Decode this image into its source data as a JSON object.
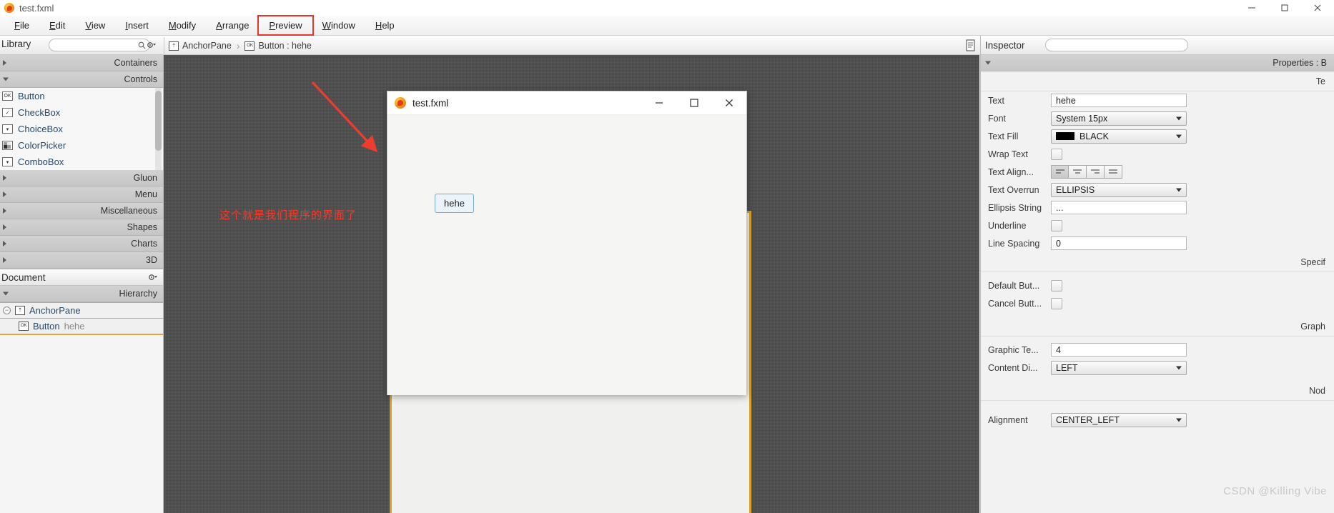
{
  "window": {
    "title": "test.fxml",
    "icon": "scenebuilder-icon",
    "controls": [
      {
        "name": "minimize",
        "glyph": "minimize-icon"
      },
      {
        "name": "maximize",
        "glyph": "maximize-icon"
      },
      {
        "name": "close",
        "glyph": "close-icon"
      }
    ]
  },
  "menubar": {
    "items": [
      {
        "label": "File",
        "mnemonic": "F",
        "highlighted": false
      },
      {
        "label": "Edit",
        "mnemonic": "E",
        "highlighted": false
      },
      {
        "label": "View",
        "mnemonic": "V",
        "highlighted": false
      },
      {
        "label": "Insert",
        "mnemonic": "I",
        "highlighted": false
      },
      {
        "label": "Modify",
        "mnemonic": "M",
        "highlighted": false
      },
      {
        "label": "Arrange",
        "mnemonic": "A",
        "highlighted": false
      },
      {
        "label": "Preview",
        "mnemonic": "P",
        "highlighted": true
      },
      {
        "label": "Window",
        "mnemonic": "W",
        "highlighted": false
      },
      {
        "label": "Help",
        "mnemonic": "H",
        "highlighted": false
      }
    ],
    "highlight_color": "#e8342a"
  },
  "library": {
    "title": "Library",
    "search_placeholder": "",
    "search_value": "",
    "gear_label": "gear-icon",
    "sections": [
      {
        "label": "Containers",
        "open": false
      },
      {
        "label": "Controls",
        "open": true
      }
    ],
    "controls": [
      {
        "label": "Button",
        "icon": "ok-icon"
      },
      {
        "label": "CheckBox",
        "icon": "checkbox-icon"
      },
      {
        "label": "ChoiceBox",
        "icon": "choicebox-icon"
      },
      {
        "label": "ColorPicker",
        "icon": "colorpicker-icon"
      },
      {
        "label": "ComboBox",
        "icon": "combobox-icon"
      }
    ],
    "more_sections": [
      {
        "label": "Gluon"
      },
      {
        "label": "Menu"
      },
      {
        "label": "Miscellaneous"
      },
      {
        "label": "Shapes"
      },
      {
        "label": "Charts"
      },
      {
        "label": "3D"
      }
    ]
  },
  "document": {
    "title": "Document",
    "hierarchy_label": "Hierarchy",
    "tree": [
      {
        "label": "AnchorPane",
        "sub": "",
        "icon": "anchorpane-icon",
        "depth": 0,
        "expanded": true
      },
      {
        "label": "Button",
        "sub": "hehe",
        "icon": "ok-icon",
        "depth": 1,
        "expanded": false
      }
    ]
  },
  "breadcrumb": {
    "items": [
      {
        "label": "AnchorPane",
        "icon": "anchorpane-icon"
      },
      {
        "label": "Button : hehe",
        "icon": "ok-icon"
      }
    ],
    "separator": "›",
    "doc_icon": "document-icon"
  },
  "canvas": {
    "annotation_text": "这个就是我们程序的界面了",
    "annotation_color": "#f03c2e",
    "arrow": "red-arrow",
    "stage_border_color": "#d8a12a"
  },
  "preview": {
    "title": "test.fxml",
    "icon": "scenebuilder-icon",
    "controls": [
      {
        "name": "minimize",
        "glyph": "minimize-icon"
      },
      {
        "name": "maximize",
        "glyph": "maximize-icon"
      },
      {
        "name": "close",
        "glyph": "close-icon"
      }
    ],
    "button_label": "hehe"
  },
  "inspector": {
    "title": "Inspector",
    "search_value": "",
    "accordion_label": "Properties : B",
    "sections": [
      {
        "label": "Te"
      },
      {
        "label": "Specif"
      },
      {
        "label": "Graph"
      },
      {
        "label": "Nod"
      }
    ],
    "text_props": [
      {
        "label": "Text",
        "type": "text",
        "value": "hehe"
      },
      {
        "label": "Font",
        "type": "select",
        "value": "System 15px"
      },
      {
        "label": "Text Fill",
        "type": "color",
        "value": "BLACK",
        "color": "#000000"
      },
      {
        "label": "Wrap Text",
        "type": "checkbox",
        "value": false
      },
      {
        "label": "Text Align...",
        "type": "align",
        "value": "LEFT"
      },
      {
        "label": "Text Overrun",
        "type": "select",
        "value": "ELLIPSIS"
      },
      {
        "label": "Ellipsis String",
        "type": "text",
        "value": "..."
      },
      {
        "label": "Underline",
        "type": "checkbox",
        "value": false
      },
      {
        "label": "Line Spacing",
        "type": "text",
        "value": "0"
      }
    ],
    "specific_props": [
      {
        "label": "Default But...",
        "type": "checkbox",
        "value": false
      },
      {
        "label": "Cancel Butt...",
        "type": "checkbox",
        "value": false
      }
    ],
    "graphic_props": [
      {
        "label": "Graphic Te...",
        "type": "text",
        "value": "4"
      },
      {
        "label": "Content Di...",
        "type": "select",
        "value": "LEFT"
      }
    ],
    "node_props": [
      {
        "label": "Alignment",
        "type": "select",
        "value": "CENTER_LEFT"
      }
    ]
  },
  "watermark": "CSDN @Killing Vibe"
}
